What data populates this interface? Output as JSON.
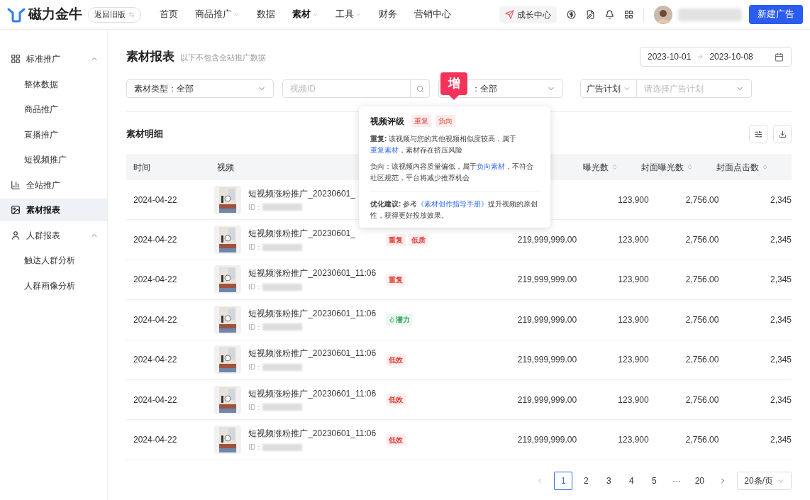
{
  "header": {
    "logo": "磁力金牛",
    "old_version": "返回旧版",
    "nav": [
      {
        "label": "首页",
        "dropdown": false,
        "selected": false
      },
      {
        "label": "商品推广",
        "dropdown": true,
        "selected": false
      },
      {
        "label": "数据",
        "dropdown": false,
        "selected": false
      },
      {
        "label": "素材",
        "dropdown": true,
        "selected": true
      },
      {
        "label": "工具",
        "dropdown": true,
        "selected": false
      },
      {
        "label": "财务",
        "dropdown": false,
        "selected": false
      },
      {
        "label": "营销中心",
        "dropdown": false,
        "selected": false
      }
    ],
    "growth": "成长中心",
    "create": "新建广告"
  },
  "sidebar": [
    {
      "label": "标准推广",
      "expanded": true,
      "selected": false,
      "children": [
        {
          "label": "整体数据",
          "selected": false
        },
        {
          "label": "商品推广",
          "selected": false
        },
        {
          "label": "直播推广",
          "selected": false
        },
        {
          "label": "短视频推广",
          "selected": false
        }
      ]
    },
    {
      "label": "全站推广",
      "selected": false
    },
    {
      "label": "素材报表",
      "selected": true
    },
    {
      "label": "人群报表",
      "expanded": true,
      "selected": false,
      "children": [
        {
          "label": "触达人群分析",
          "selected": false
        },
        {
          "label": "人群画像分析",
          "selected": false
        }
      ]
    }
  ],
  "page": {
    "title": "素材报表",
    "subtitle": "以下不包含全站推广数据",
    "date_start": "2023-10-01",
    "date_end": "2023-10-08"
  },
  "filters": {
    "type_label": "素材类型：",
    "type_value": "全部",
    "video_id_placeholder": "视频ID",
    "third_prefix": "：",
    "third_value": "全部",
    "plan_label": "广告计划",
    "plan_placeholder": "请选择广告计划"
  },
  "badge": "增",
  "section_title": "素材明细",
  "table": {
    "columns": [
      "时间",
      "视频",
      "曝光数",
      "封面曝光数",
      "封面点击数"
    ],
    "rows": [
      {
        "time": "2024-04-22",
        "video": "短视频涨粉推广_20230601_",
        "id_label": "ID：",
        "tags": [],
        "exposure": "123,900",
        "cover_exposure": "2,756.00",
        "cover_clicks": "2,345"
      },
      {
        "time": "2024-04-22",
        "video": "短视频涨粉推广_20230601_",
        "id_label": "ID：",
        "tags": [
          {
            "label": "重复",
            "color": "#e5403a"
          },
          {
            "label": "低质",
            "color": "#e5403a"
          }
        ],
        "amount": "219,999,999.00",
        "exposure": "123,900",
        "cover_exposure": "2,756.00",
        "cover_clicks": "2,345"
      },
      {
        "time": "2024-04-22",
        "video": "短视频涨粉推广_20230601_11:06",
        "id_label": "ID：",
        "tags": [
          {
            "label": "重复",
            "color": "#e5403a"
          }
        ],
        "amount": "219,999,999.00",
        "exposure": "123,900",
        "cover_exposure": "2,756.00",
        "cover_clicks": "2,345"
      },
      {
        "time": "2024-04-22",
        "video": "短视频涨粉推广_20230601_11:06",
        "id_label": "ID：",
        "tags": [
          {
            "label": "潜力",
            "color": "#1f9d55",
            "kind": "fire"
          }
        ],
        "amount": "219,999,999.00",
        "exposure": "123,900",
        "cover_exposure": "2,756.00",
        "cover_clicks": "2,345"
      },
      {
        "time": "2024-04-22",
        "video": "短视频涨粉推广_20230601_11:06",
        "id_label": "ID：",
        "tags": [
          {
            "label": "低效",
            "color": "#e5403a"
          }
        ],
        "amount": "219,999,999.00",
        "exposure": "123,900",
        "cover_exposure": "2,756.00",
        "cover_clicks": "2,345"
      },
      {
        "time": "2024-04-22",
        "video": "短视频涨粉推广_20230601_11:06",
        "id_label": "ID：",
        "tags": [
          {
            "label": "低效",
            "color": "#e5403a"
          }
        ],
        "amount": "219,999,999.00",
        "exposure": "123,900",
        "cover_exposure": "2,756.00",
        "cover_clicks": "2,345"
      },
      {
        "time": "2024-04-22",
        "video": "短视频涨粉推广_20230601_11:06",
        "id_label": "ID：",
        "tags": [
          {
            "label": "低效",
            "color": "#e5403a"
          }
        ],
        "amount": "219,999,999.00",
        "exposure": "123,900",
        "cover_exposure": "2,756.00",
        "cover_clicks": "2,345"
      }
    ]
  },
  "popover": {
    "title": "视频评级",
    "tags": [
      "重复",
      "负向"
    ],
    "p1": "**重复:** 该视频与您的其他视频相似度较高，属于",
    "p1_link": "重复素材",
    "p1_end": "，素材存在挤压风险",
    "p2": "负向：该视频内容质量偏低，属于",
    "p2_link": "负向素材",
    "p2_end": "，不符合社区规范，平台将减少推荐机会",
    "p3": "**优化建议:** 参考",
    "p3_link": "《素材创作指导手册》",
    "p3_end": "提升视频的原创性，获得更好投放效果。"
  },
  "pagination": {
    "pages": [
      {
        "label": "1",
        "selected": true
      },
      {
        "label": "2",
        "selected": false
      },
      {
        "label": "3",
        "selected": false
      },
      {
        "label": "4",
        "selected": false
      },
      {
        "label": "5",
        "selected": false
      },
      {
        "label": "···",
        "selected": false
      },
      {
        "label": "20",
        "selected": false
      }
    ],
    "page_size": "20条/页"
  }
}
